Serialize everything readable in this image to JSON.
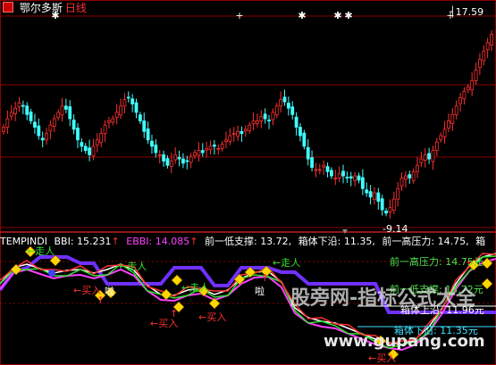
{
  "header": {
    "stock_name": "鄂尔多斯",
    "period": "日线"
  },
  "top_price_labels": {
    "high": "17.59",
    "low": "9.14"
  },
  "indicator": {
    "name": "TEMPINDI",
    "items": [
      {
        "label": "BBI:",
        "value": "15.231",
        "arrow": "↑",
        "color": "#ffffff"
      },
      {
        "label": "EBBI:",
        "value": "14.085",
        "arrow": "↑",
        "color": "#ff40ff"
      },
      {
        "label": "前一低支撑:",
        "value": "13.72,",
        "arrow": "",
        "color": "#ffffff"
      },
      {
        "label": "箱体下沿:",
        "value": "11.35,",
        "arrow": "",
        "color": "#40e0ff"
      },
      {
        "label": "前一高压力:",
        "value": "14.75,",
        "arrow": "",
        "color": "#ffffff"
      },
      {
        "label": "箱",
        "value": "",
        "arrow": "",
        "color": "#ffffff"
      }
    ]
  },
  "right_labels": [
    {
      "text": "前一高压力: 14.75元",
      "color": "#50e050"
    },
    {
      "text": "前一低支撑: 13.72元",
      "color": "#50e050"
    },
    {
      "text": "箱体上沿: 11.96元",
      "color": "#ffffff"
    },
    {
      "text": "箱体下沿: 11.35元",
      "color": "#40e0ff"
    }
  ],
  "signals": {
    "zou": "←走人",
    "mai": "←买入",
    "la": "啦"
  },
  "watermark": {
    "line1": "股旁网-指标公式大全",
    "line2": "www.gupang.com"
  },
  "colors": {
    "up": "#ff3030",
    "down": "#40ffff",
    "grid": "#8b0000"
  },
  "chart_data": [
    {
      "type": "candlestick",
      "title": "鄂尔多斯 日线",
      "annotated_high": 17.59,
      "annotated_low": 9.14,
      "ylim": [
        8.5,
        18.2
      ],
      "close_series": [
        13.2,
        13.6,
        13.9,
        14.1,
        14.35,
        14.2,
        13.8,
        13.5,
        13.2,
        12.8,
        12.6,
        12.9,
        13.3,
        13.6,
        13.9,
        14.2,
        14.05,
        13.6,
        13.1,
        12.6,
        12.3,
        12.1,
        11.9,
        12.3,
        12.6,
        12.9,
        13.3,
        13.5,
        13.6,
        13.9,
        14.2,
        14.5,
        14.6,
        14.3,
        13.9,
        13.5,
        13.0,
        12.6,
        12.3,
        12.0,
        11.9,
        11.6,
        11.4,
        11.6,
        11.9,
        11.7,
        11.5,
        11.6,
        11.8,
        12.0,
        12.1,
        12.0,
        12.2,
        12.3,
        12.3,
        12.2,
        12.4,
        12.6,
        12.8,
        12.9,
        13.0,
        12.9,
        13.1,
        13.3,
        13.5,
        13.5,
        13.7,
        13.6,
        13.5,
        13.9,
        14.2,
        14.5,
        14.4,
        14.1,
        13.8,
        13.2,
        12.8,
        12.3,
        11.7,
        11.3,
        11.2,
        11.2,
        11.4,
        11.1,
        10.9,
        10.8,
        11.0,
        10.9,
        10.8,
        10.8,
        10.9,
        10.7,
        10.3,
        10.1,
        9.9,
        10.1,
        9.7,
        9.3,
        9.14,
        9.4,
        9.8,
        10.3,
        10.8,
        10.9,
        10.8,
        11.1,
        11.4,
        11.7,
        11.9,
        11.7,
        12.1,
        12.5,
        12.8,
        13.1,
        13.5,
        13.8,
        14.2,
        14.6,
        14.9,
        15.1,
        15.4,
        15.9,
        16.4,
        16.8,
        17.2,
        17.59
      ]
    },
    {
      "type": "line",
      "title": "TEMPINDI",
      "series": [
        {
          "name": "BBI",
          "last": 15.231
        },
        {
          "name": "EBBI",
          "last": 14.085
        },
        {
          "name": "前一低支撑",
          "last": 13.72
        },
        {
          "name": "箱体下沿",
          "last": 11.35
        },
        {
          "name": "前一高压力",
          "last": 14.75
        },
        {
          "name": "箱体上沿",
          "last": 11.96
        }
      ]
    }
  ]
}
